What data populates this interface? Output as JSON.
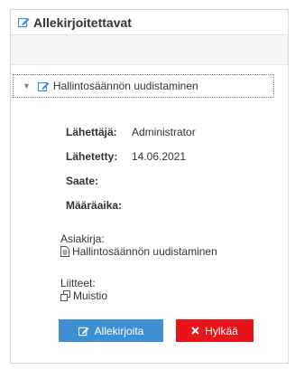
{
  "panel": {
    "title": "Allekirjoitettavat"
  },
  "item": {
    "label": "Hallintosäännön uudistaminen"
  },
  "details": {
    "sender_label": "Lähettäjä:",
    "sender_value": "Administrator",
    "sent_label": "Lähetetty:",
    "sent_value": "14.06.2021",
    "message_label": "Saate:",
    "message_value": "",
    "deadline_label": "Määräaika:",
    "deadline_value": ""
  },
  "document": {
    "label": "Asiakirja:",
    "name": "Hallintosäännön uudistaminen"
  },
  "attachments": {
    "label": "Liitteet:",
    "items": [
      "Muistio"
    ]
  },
  "actions": {
    "sign_label": "Allekirjoita",
    "reject_label": "Hylkää"
  },
  "colors": {
    "accent": "#3d8fd1",
    "danger": "#e8141a"
  }
}
